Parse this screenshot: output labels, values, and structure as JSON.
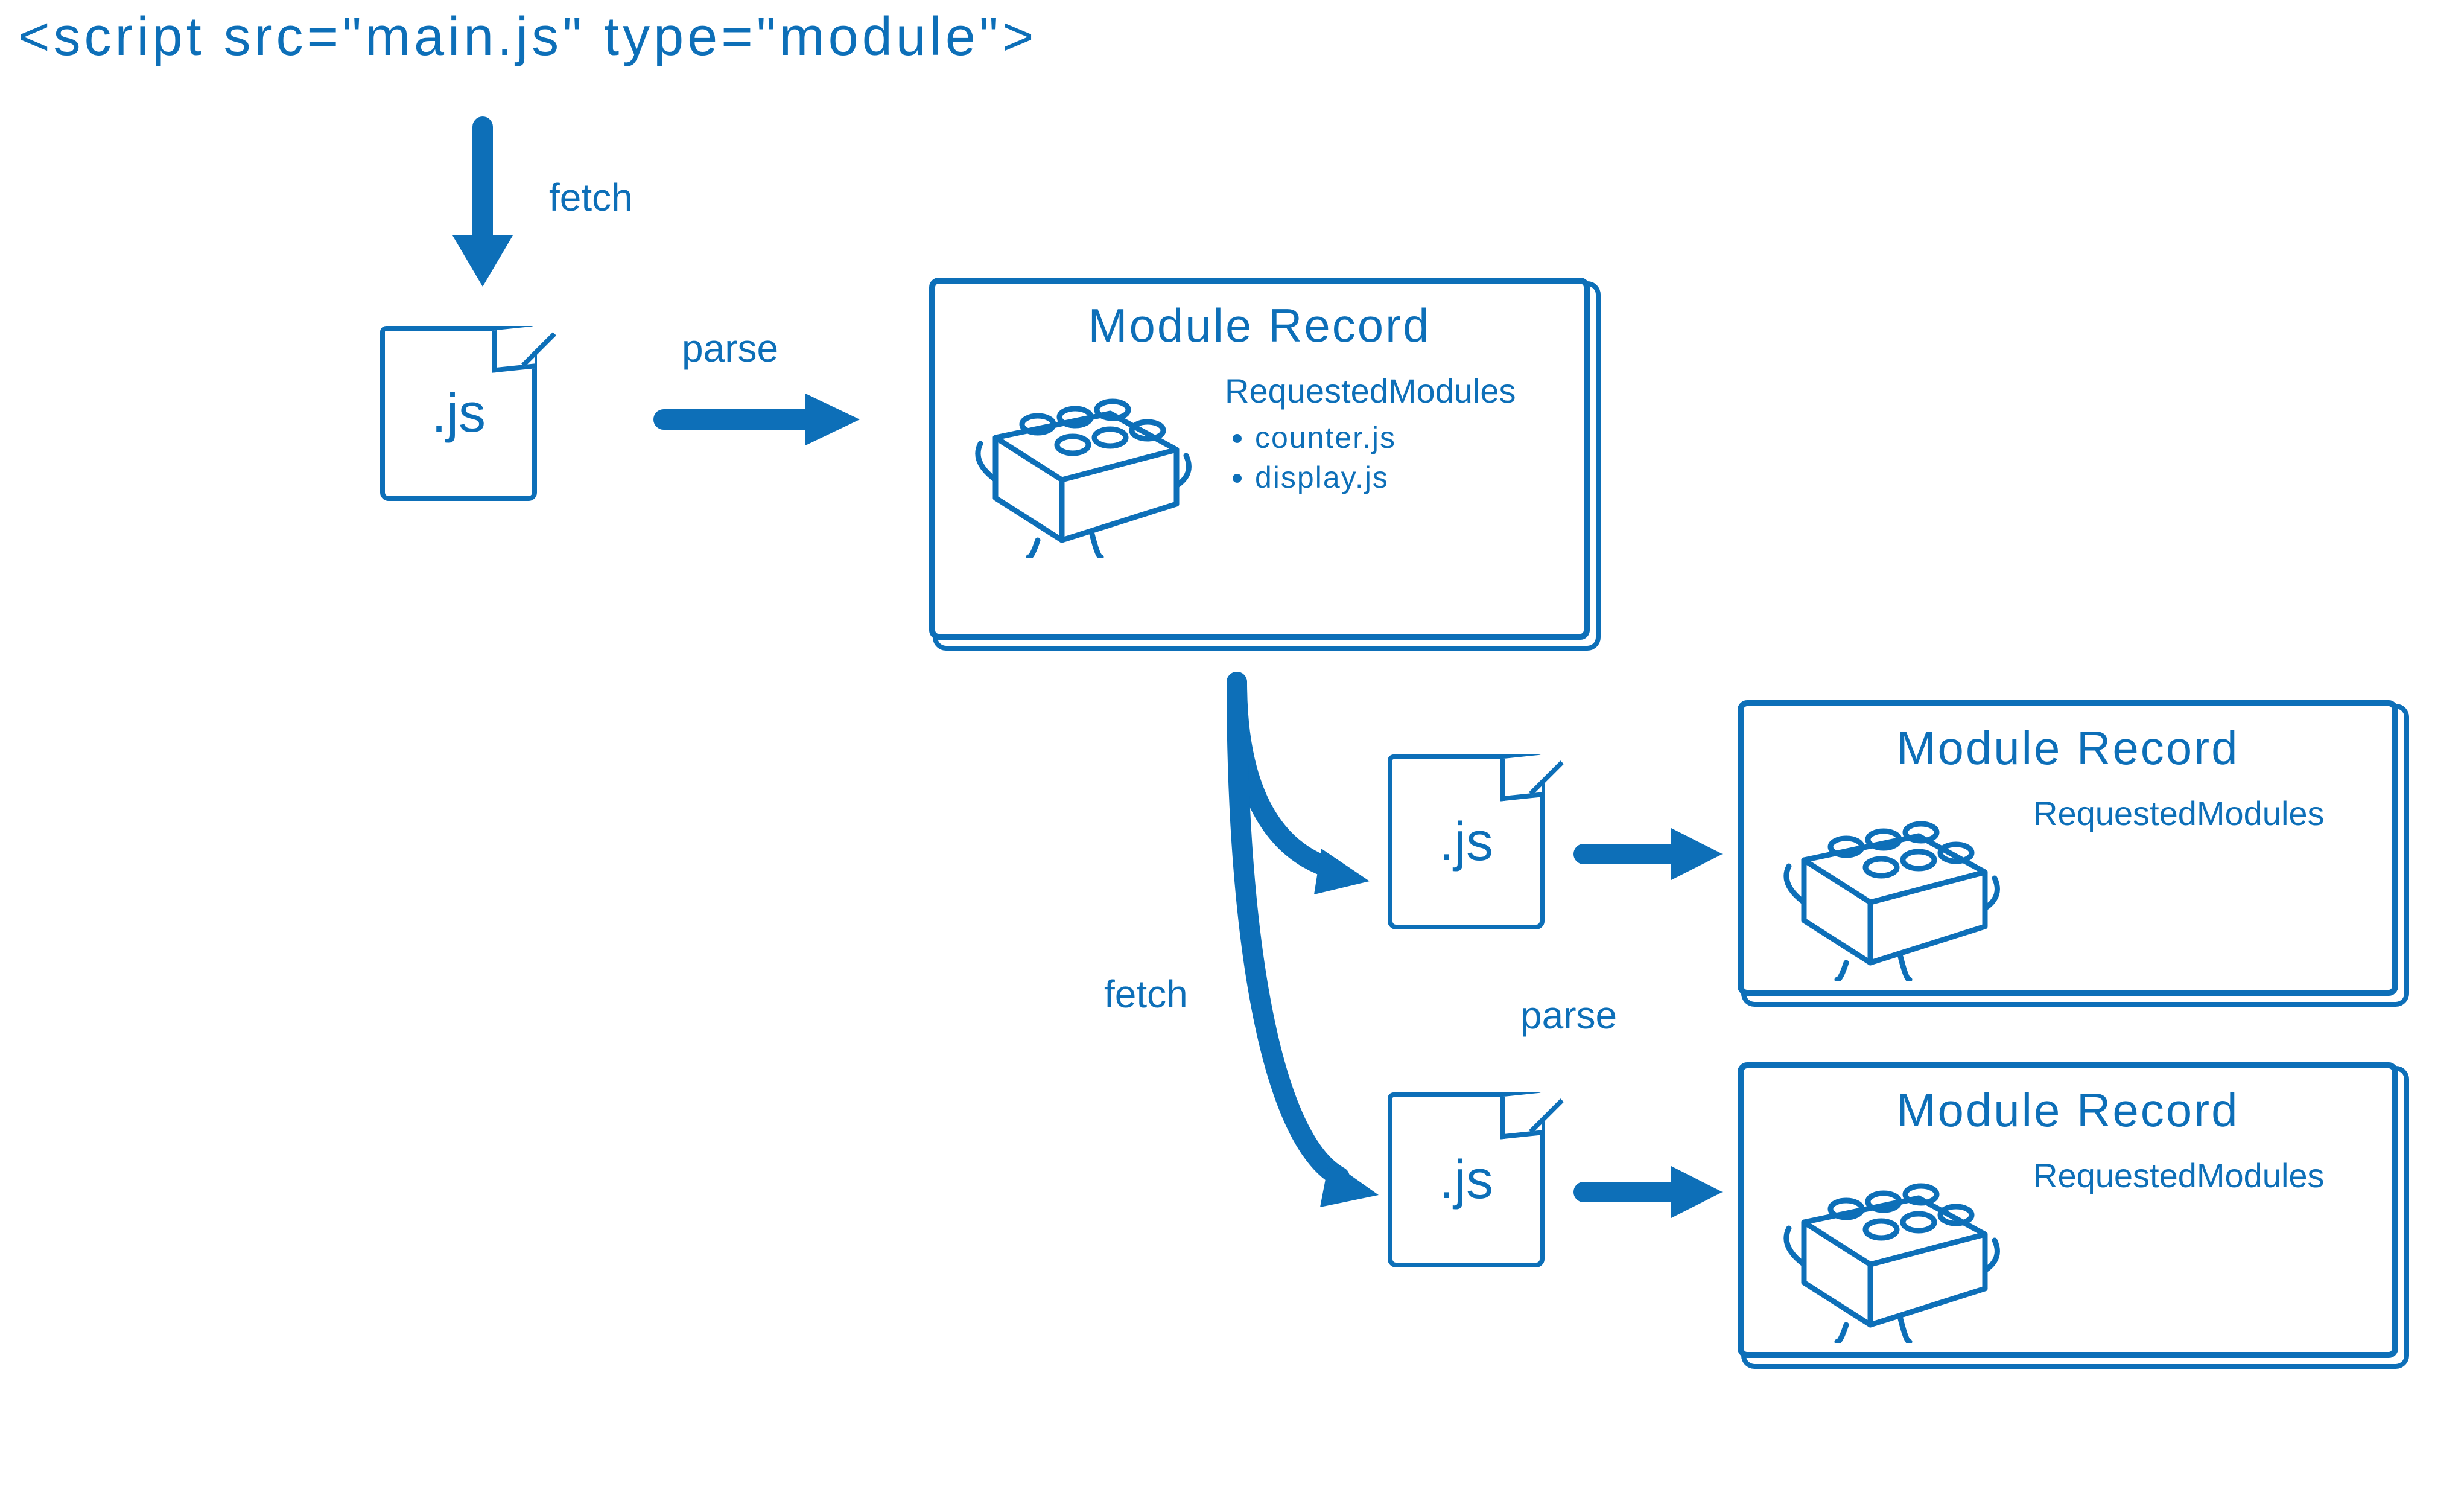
{
  "scriptTag": "<script  src=\"main.js\"  type=\"module\">",
  "labels": {
    "fetch1": "fetch",
    "parse1": "parse",
    "fetch2": "fetch",
    "parse2": "parse",
    "js": ".js"
  },
  "record1": {
    "title": "Module Record",
    "requestedHeader": "RequestedModules",
    "items": [
      "counter.js",
      "display.js"
    ]
  },
  "record2": {
    "title": "Module Record",
    "requestedHeader": "RequestedModules"
  },
  "record3": {
    "title": "Module Record",
    "requestedHeader": "RequestedModules"
  }
}
